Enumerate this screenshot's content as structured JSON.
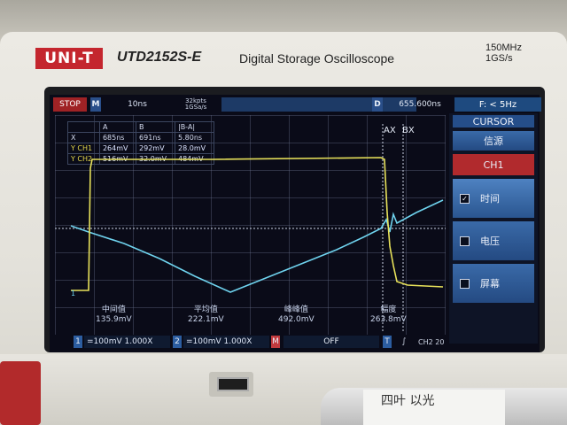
{
  "brand": {
    "logo_text": "UNI-T",
    "model": "UTD2152S-E",
    "description": "Digital Storage Oscilloscope",
    "spec_bandwidth": "150MHz",
    "spec_rate": "1GS/s"
  },
  "topbar": {
    "run_state": "STOP",
    "m_label": "M",
    "timebase": "10ns",
    "mem_depth": "32kpts",
    "sample_rate": "1GSa/s",
    "d_label": "D",
    "delay": "655.600ns",
    "freq": "F: < 5Hz"
  },
  "readout": {
    "headers": [
      "",
      "A",
      "B",
      "|B-A|"
    ],
    "rows": [
      {
        "key": "X",
        "a": "685ns",
        "b": "691ns",
        "d": "5.80ns"
      },
      {
        "key": "Y CH1",
        "a": "264mV",
        "b": "292mV",
        "d": "28.0mV"
      },
      {
        "key": "Y CH2",
        "a": "516mV",
        "b": "32.0mV",
        "d": "484mV"
      }
    ]
  },
  "cursor_labels": {
    "ax": "AX",
    "bx": "BX"
  },
  "side_menu": {
    "title": "CURSOR",
    "source": "信源",
    "channel": "CH1",
    "time": "时间",
    "voltage": "电压",
    "screen": "屏幕"
  },
  "measurements": [
    {
      "name": "中间值",
      "value": "135.9mV"
    },
    {
      "name": "平均值",
      "value": "222.1mV"
    },
    {
      "name": "峰峰值",
      "value": "492.0mV"
    },
    {
      "name": "幅度",
      "value": "263.8mV"
    }
  ],
  "bottom": {
    "ch1_num": "1",
    "ch1_scale": "=100mV 1.000X",
    "ch2_num": "2",
    "ch2_scale": "=100mV 1.000X",
    "math": "M",
    "math_state": "OFF",
    "trig": "T",
    "trig_edge": "∫",
    "trig_src": "CH2 20"
  },
  "handwriting": "四叶 以光",
  "colors": {
    "ch1": "#e8e25a",
    "ch2": "#6fd3ee",
    "accent_red": "#b12a2d",
    "menu_blue": "#2a5690"
  }
}
